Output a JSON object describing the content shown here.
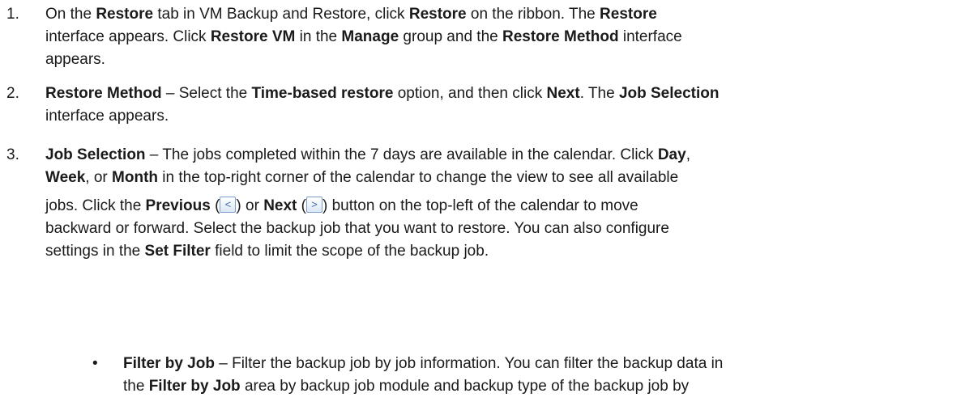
{
  "steps": [
    {
      "number": "1.",
      "lines": [
        [
          {
            "t": "On the "
          },
          {
            "t": "Restore",
            "b": true
          },
          {
            "t": " tab in VM Backup and Restore, click "
          },
          {
            "t": "Restore",
            "b": true
          },
          {
            "t": " on the ribbon. The "
          },
          {
            "t": "Restore",
            "b": true
          }
        ],
        [
          {
            "t": "interface appears. Click "
          },
          {
            "t": "Restore VM",
            "b": true
          },
          {
            "t": " in the "
          },
          {
            "t": "Manage",
            "b": true
          },
          {
            "t": " group and the "
          },
          {
            "t": "Restore Method",
            "b": true
          },
          {
            "t": " interface"
          }
        ],
        [
          {
            "t": "appears."
          }
        ]
      ]
    },
    {
      "number": "2.",
      "lines": [
        [
          {
            "t": "Restore Method",
            "b": true
          },
          {
            "t": " – Select the "
          },
          {
            "t": "Time-based restore",
            "b": true
          },
          {
            "t": " option, and then click "
          },
          {
            "t": "Next",
            "b": true
          },
          {
            "t": ". The "
          },
          {
            "t": "Job Selection",
            "b": true
          }
        ],
        [
          {
            "t": "interface appears."
          }
        ]
      ]
    },
    {
      "number": "3.",
      "lines": [
        [
          {
            "t": "Job Selection",
            "b": true
          },
          {
            "t": " – The jobs completed within the 7 days are available in the calendar. Click "
          },
          {
            "t": "Day",
            "b": true
          },
          {
            "t": ","
          }
        ],
        [
          {
            "t": "Week",
            "b": true
          },
          {
            "t": ", or "
          },
          {
            "t": "Month",
            "b": true
          },
          {
            "t": " in the top-right corner of the calendar to change the view to see all available"
          }
        ],
        [
          {
            "t": "jobs. Click the "
          },
          {
            "t": "Previous",
            "b": true
          },
          {
            "t": " ("
          },
          {
            "icon": "previous-button-icon",
            "glyph": "<"
          },
          {
            "t": ") or "
          },
          {
            "t": "Next",
            "b": true
          },
          {
            "t": " ("
          },
          {
            "icon": "next-button-icon",
            "glyph": ">"
          },
          {
            "t": ") button on the top-left of the calendar to move"
          }
        ],
        [
          {
            "t": "backward or forward. Select the backup job that you want to restore. You can also configure"
          }
        ],
        [
          {
            "t": "settings in the "
          },
          {
            "t": "Set Filter",
            "b": true
          },
          {
            "t": " field to limit the scope of the backup job."
          }
        ]
      ]
    }
  ],
  "bullets": [
    {
      "marker": "•",
      "lines": [
        [
          {
            "t": "Filter by Job",
            "b": true
          },
          {
            "t": " – Filter the backup job by job information. You can filter the backup data in"
          }
        ],
        [
          {
            "t": "the "
          },
          {
            "t": "Filter by Job",
            "b": true
          },
          {
            "t": " area by backup job module and backup type of the backup job by"
          }
        ]
      ]
    }
  ]
}
